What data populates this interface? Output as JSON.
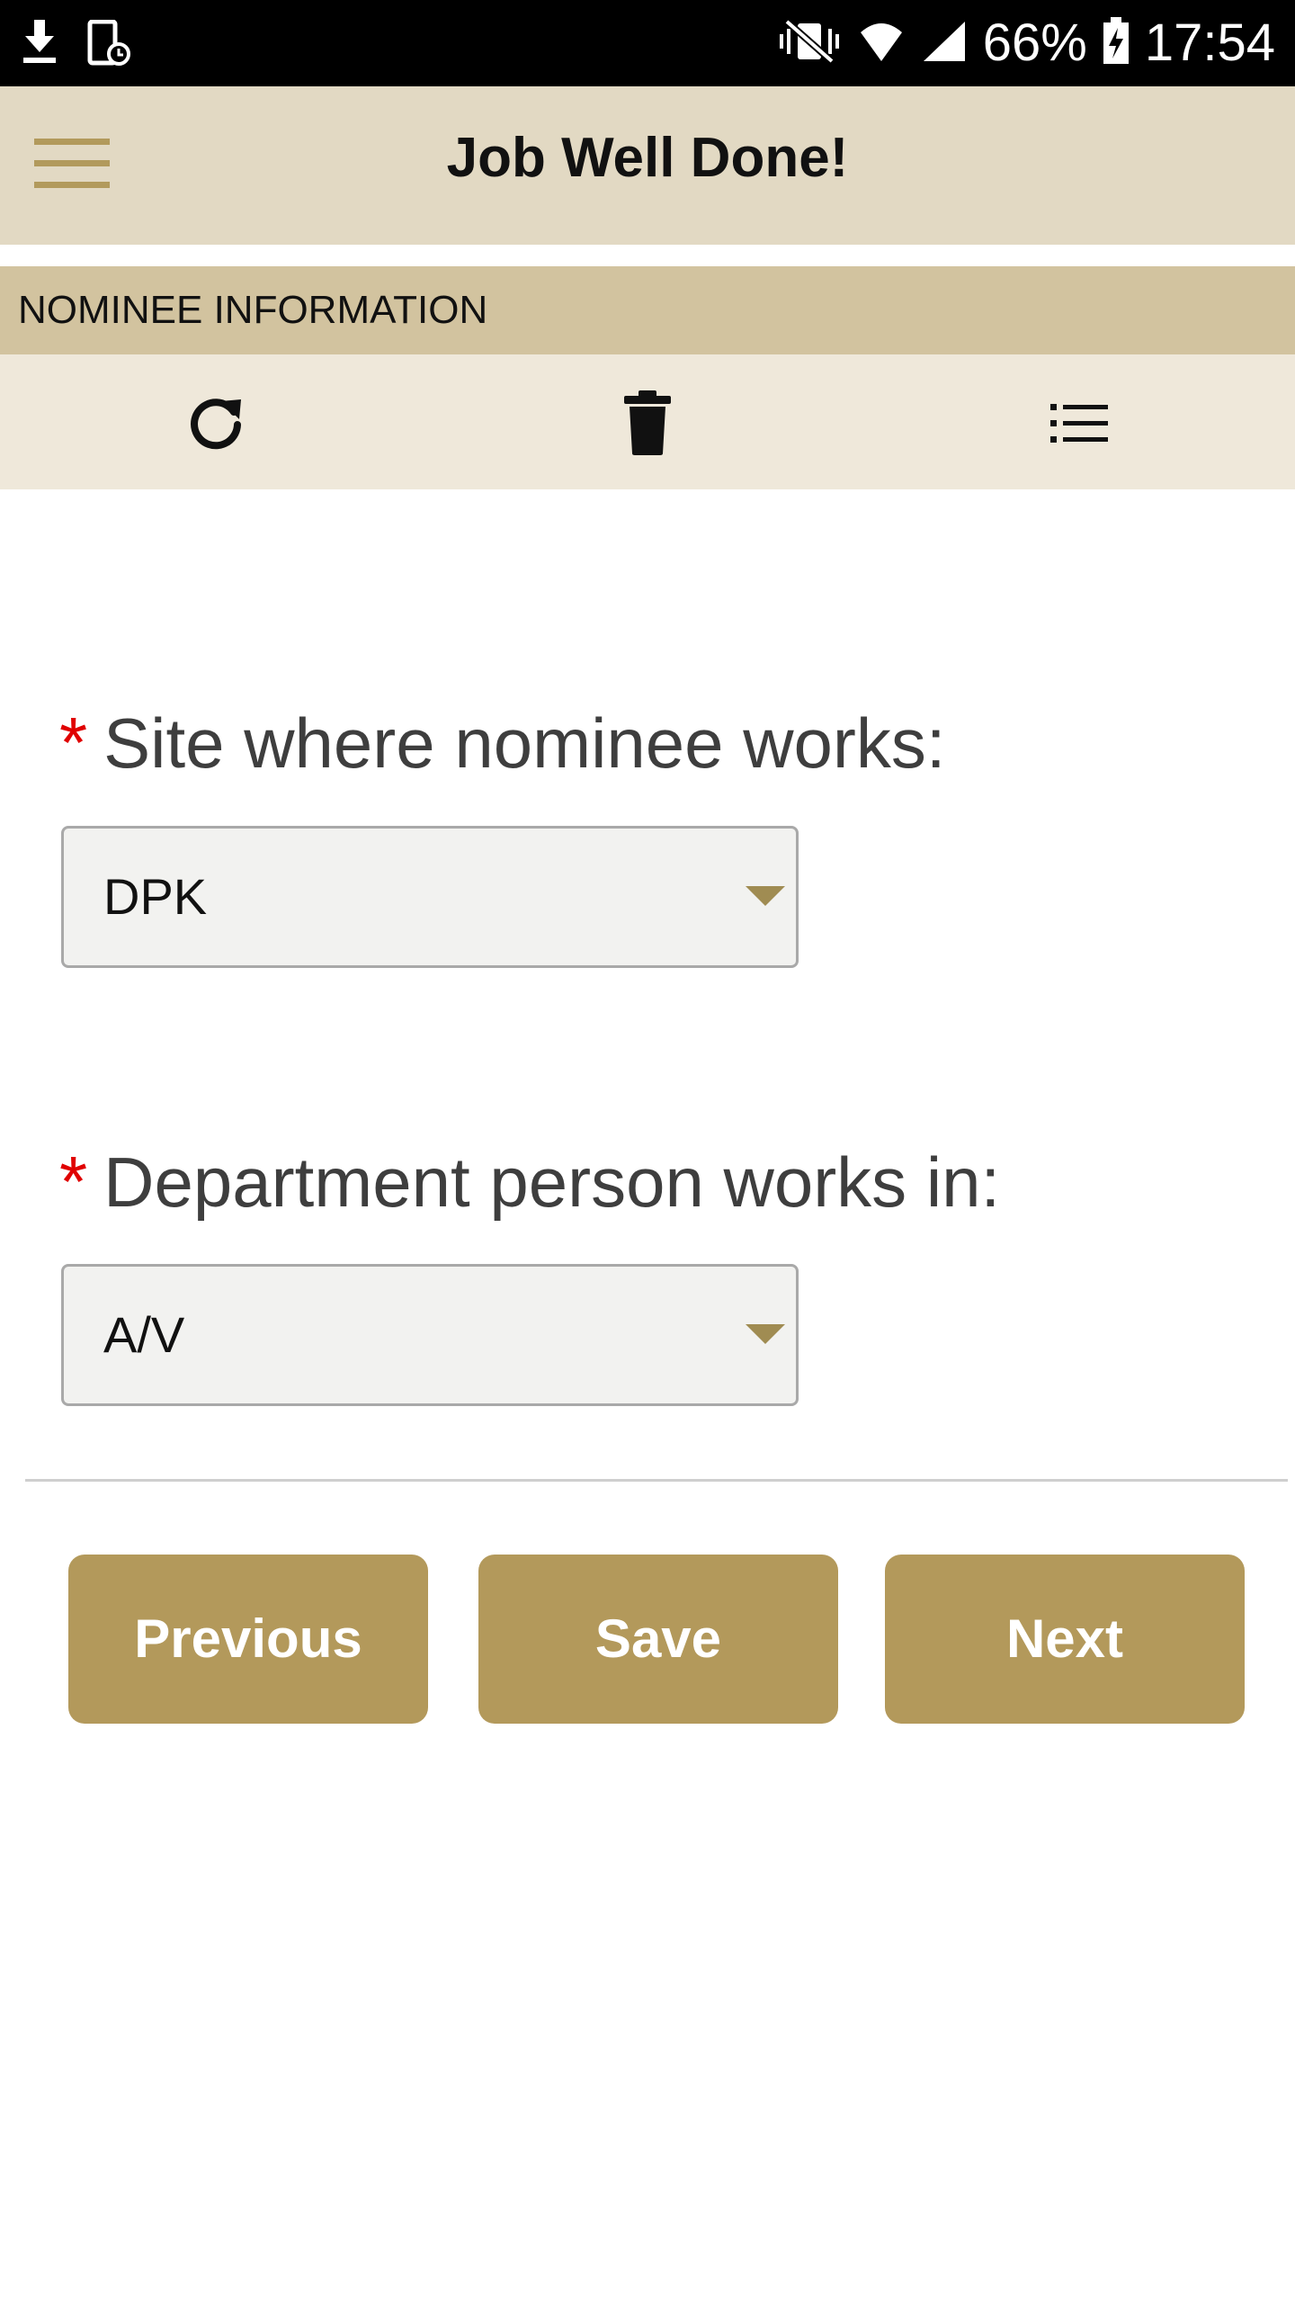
{
  "status_bar": {
    "battery": "66%",
    "time": "17:54",
    "icons": [
      "download-icon",
      "device-icon",
      "vibrate-icon",
      "wifi-icon",
      "signal-icon",
      "battery-charging-icon"
    ]
  },
  "app_bar": {
    "title": "Job Well Done!",
    "menu_icon": "hamburger-menu-icon"
  },
  "section": {
    "header": "NOMINEE INFORMATION"
  },
  "toolbar": {
    "icons": [
      "refresh-icon",
      "delete-icon",
      "list-icon"
    ]
  },
  "form": {
    "required_marker": "*",
    "site_label": "Site where nominee works:",
    "site_value": "DPK",
    "department_label": "Department person works in:",
    "department_value": "A/V"
  },
  "buttons": {
    "previous": "Previous",
    "save": "Save",
    "next": "Next"
  },
  "colors": {
    "accent": "#b3995b",
    "app_bar": "#e2d9c3",
    "section_header": "#d2c39f",
    "toolbar": "#efe8da",
    "required": "#e00000"
  }
}
